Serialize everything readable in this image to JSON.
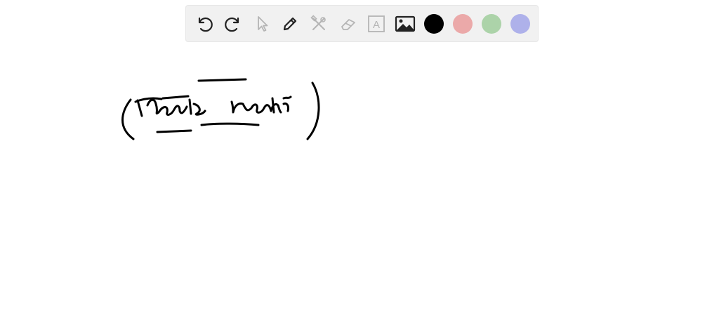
{
  "toolbar": {
    "tools": [
      {
        "name": "undo",
        "icon": "undo-icon",
        "enabled": true
      },
      {
        "name": "redo",
        "icon": "redo-icon",
        "enabled": true
      },
      {
        "name": "select",
        "icon": "cursor-icon",
        "enabled": false
      },
      {
        "name": "pen",
        "icon": "pencil-icon",
        "enabled": true
      },
      {
        "name": "tools",
        "icon": "tools-icon",
        "enabled": false
      },
      {
        "name": "eraser",
        "icon": "eraser-icon",
        "enabled": false
      },
      {
        "name": "text",
        "icon": "text-box-icon",
        "enabled": false
      },
      {
        "name": "image",
        "icon": "image-icon",
        "enabled": true
      }
    ],
    "colors": [
      {
        "name": "black",
        "hex": "#000000",
        "selected": true
      },
      {
        "name": "red",
        "hex": "#eba9a9",
        "selected": false
      },
      {
        "name": "green",
        "hex": "#acd3a9",
        "selected": false
      },
      {
        "name": "blue",
        "hex": "#aeb1ea",
        "selected": false
      }
    ],
    "text_tool_glyph": "A"
  },
  "canvas": {
    "ink_color": "#000000"
  }
}
